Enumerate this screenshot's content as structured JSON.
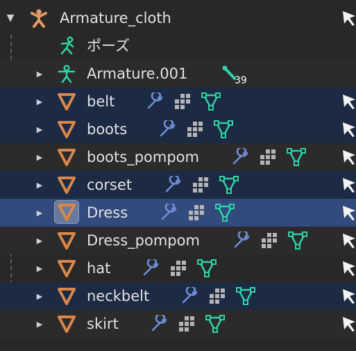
{
  "outliner": {
    "root": {
      "label": "Armature_cloth",
      "icon": "armature-person-icon"
    },
    "pose": {
      "label": "ポーズ",
      "icon": "pose-icon"
    },
    "armature_child": {
      "label": "Armature.001",
      "icon": "armature-pose-icon",
      "bone_count": "39"
    },
    "meshes": [
      {
        "label": "belt"
      },
      {
        "label": "boots"
      },
      {
        "label": "boots_pompom"
      },
      {
        "label": "corset"
      },
      {
        "label": "Dress"
      },
      {
        "label": "Dress_pompom"
      },
      {
        "label": "hat"
      },
      {
        "label": "neckbelt"
      },
      {
        "label": "skirt"
      }
    ],
    "mesh_icon": "mesh-triangle-icon",
    "modifier_icon": "wrench-modifier-icon",
    "particle_icon": "particle-grid-icon",
    "vertex_icon": "mesh-data-icon"
  },
  "colors": {
    "background": "#282828",
    "selected_row": "#1d2a44",
    "active_row": "#324b7c",
    "object_orange": "#d9874a",
    "armature_green": "#2ed3a8",
    "modifier_blue": "#6f8ed6",
    "text": "#e2e2e2"
  }
}
